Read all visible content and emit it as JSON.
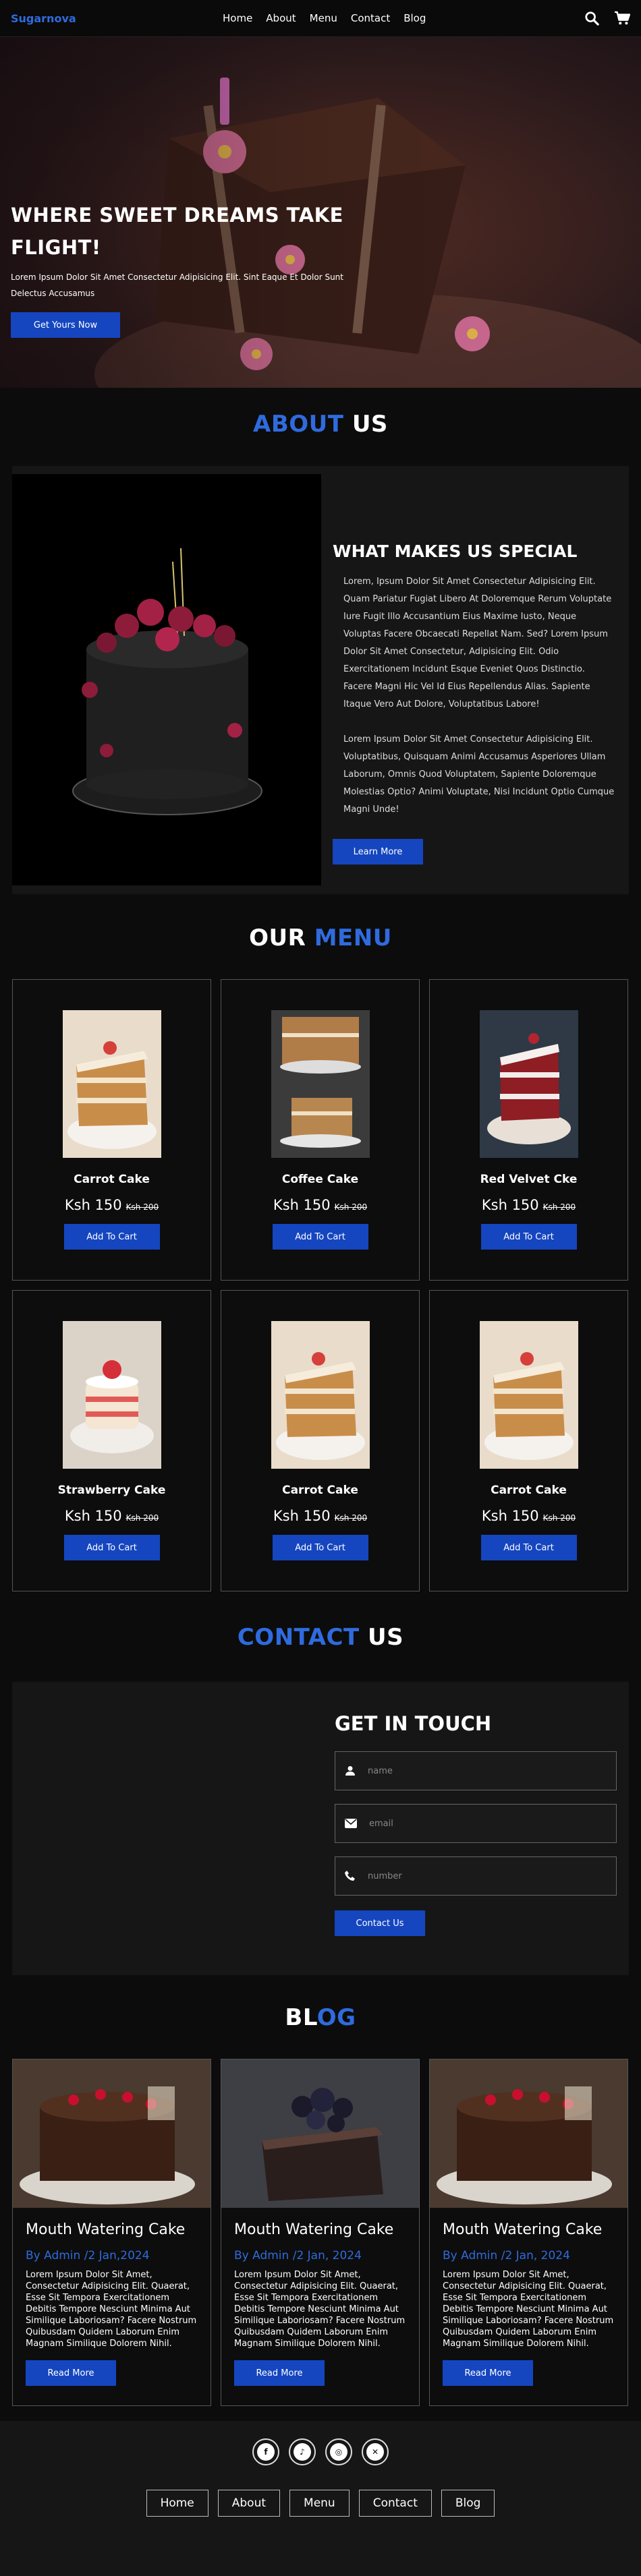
{
  "header": {
    "logo": "Sugarnova",
    "nav": [
      "Home",
      "About",
      "Menu",
      "Contact",
      "Blog"
    ]
  },
  "hero": {
    "title_line1": "WHERE SWEET DREAMS TAKE",
    "title_line2": "FLIGHT!",
    "text": "Lorem Ipsum Dolor Sit Amet Consectetur Adipisicing Elit. Sint Eaque Et Dolor Sunt Delectus Accusamus",
    "button": "Get Yours Now"
  },
  "about": {
    "title_a": "ABOUT",
    "title_b": "US",
    "heading": "WHAT MAKES US SPECIAL",
    "para1": "Lorem, Ipsum Dolor Sit Amet Consectetur Adipisicing Elit. Quam Pariatur Fugiat Libero At Doloremque Rerum Voluptate Iure Fugit Illo Accusantium Eius Maxime Iusto, Neque Voluptas Facere Obcaecati Repellat Nam. Sed? Lorem Ipsum Dolor Sit Amet Consectetur, Adipisicing Elit. Odio Exercitationem Incidunt Esque Eveniet Quos Distinctio. Facere Magni Hic Vel Id Eius Repellendus Alias. Sapiente Itaque Vero Aut Dolore, Voluptatibus Labore!",
    "para2": "Lorem Ipsum Dolor Sit Amet Consectetur Adipisicing Elit. Voluptatibus, Quisquam Animi Accusamus Asperiores Ullam Laborum, Omnis Quod Voluptatem, Sapiente Doloremque Molestias Optio? Animi Voluptate, Nisi Incidunt Optio Cumque Magni Unde!",
    "button": "Learn More"
  },
  "menu": {
    "title_a": "OUR",
    "title_b": "MENU",
    "button": "Add To Cart",
    "items": [
      {
        "name": "Carrot Cake",
        "price": "Ksh 150",
        "old": "Ksh 200",
        "img": "carrot"
      },
      {
        "name": "Coffee Cake",
        "price": "Ksh 150",
        "old": "Ksh 200",
        "img": "coffee"
      },
      {
        "name": "Red Velvet Cke",
        "price": "Ksh 150",
        "old": "Ksh 200",
        "img": "redvelvet"
      },
      {
        "name": "Strawberry Cake",
        "price": "Ksh 150",
        "old": "Ksh 200",
        "img": "strawberry"
      },
      {
        "name": "Carrot Cake",
        "price": "Ksh 150",
        "old": "Ksh 200",
        "img": "carrot"
      },
      {
        "name": "Carrot Cake",
        "price": "Ksh 150",
        "old": "Ksh 200",
        "img": "carrot"
      }
    ]
  },
  "contact": {
    "title_a": "CONTACT",
    "title_b": "US",
    "heading": "GET IN TOUCH",
    "name_placeholder": "name",
    "email_placeholder": "email",
    "number_placeholder": "number",
    "button": "Contact Us"
  },
  "blog": {
    "title_a": "BL",
    "title_b": "OG",
    "button": "Read More",
    "posts": [
      {
        "title": "Mouth Watering Cake",
        "meta": "By Admin /2 Jan,2024",
        "text": "Lorem Ipsum Dolor Sit Amet, Consectetur Adipisicing Elit. Quaerat, Esse Sit Tempora Exercitationem Debitis Tempore Nesciunt Minima Aut Similique Laboriosam? Facere Nostrum Quibusdam Quidem Laborum Enim Magnam Similique Dolorem Nihil.",
        "img": "choc"
      },
      {
        "title": "Mouth Watering Cake",
        "meta": "By Admin /2 Jan, 2024",
        "text": "Lorem Ipsum Dolor Sit Amet, Consectetur Adipisicing Elit. Quaerat, Esse Sit Tempora Exercitationem Debitis Tempore Nesciunt Minima Aut Similique Laboriosam? Facere Nostrum Quibusdam Quidem Laborum Enim Magnam Similique Dolorem Nihil.",
        "img": "berry"
      },
      {
        "title": "Mouth Watering Cake",
        "meta": "By Admin /2 Jan, 2024",
        "text": "Lorem Ipsum Dolor Sit Amet, Consectetur Adipisicing Elit. Quaerat, Esse Sit Tempora Exercitationem Debitis Tempore Nesciunt Minima Aut Similique Laboriosam? Facere Nostrum Quibusdam Quidem Laborum Enim Magnam Similique Dolorem Nihil.",
        "img": "choc"
      }
    ]
  },
  "footer": {
    "socials": [
      "facebook-icon",
      "tiktok-icon",
      "instagram-icon",
      "twitter-icon"
    ],
    "nav": [
      "Home",
      "About",
      "Menu",
      "Contact",
      "Blog"
    ]
  },
  "colors": {
    "accent": "#2f6bde",
    "button": "#1546c0",
    "background": "#0c0c0c",
    "panel": "#161616"
  }
}
